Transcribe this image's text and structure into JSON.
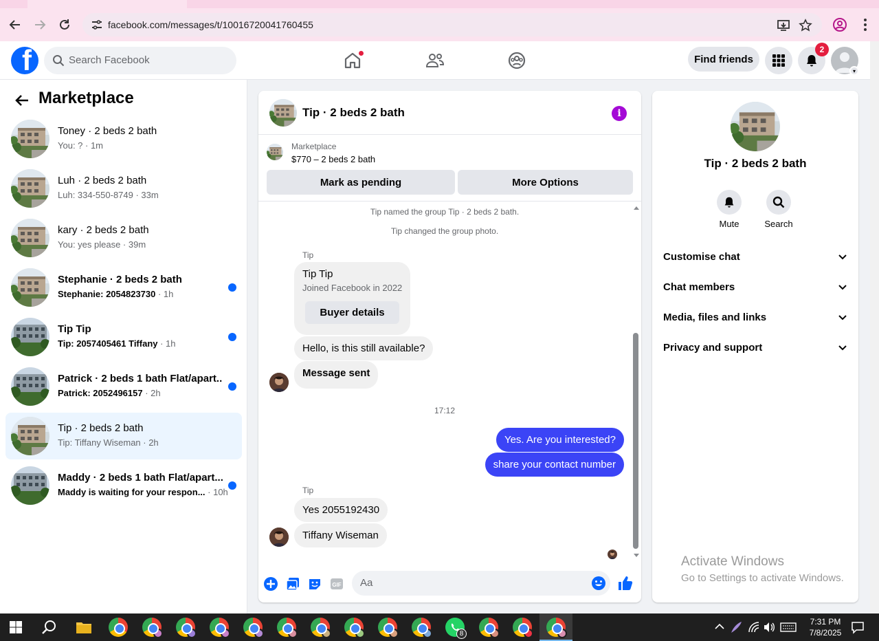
{
  "browser": {
    "url": "facebook.com/messages/t/10016720041760455"
  },
  "header": {
    "search_placeholder": "Search Facebook",
    "find_friends": "Find friends",
    "notification_count": "2"
  },
  "sidebar": {
    "title": "Marketplace",
    "conversations": [
      {
        "name": "Toney · 2 beds 2 bath",
        "preview": "You: ? · 1m",
        "unread": false,
        "active": false
      },
      {
        "name": "Luh · 2 beds 2 bath",
        "preview": "Luh: 334-550-8749 · 33m",
        "unread": false,
        "active": false
      },
      {
        "name": "kary · 2 beds 2 bath",
        "preview": "You: yes please · 39m",
        "unread": false,
        "active": false
      },
      {
        "name": "Stephanie · 2 beds 2 bath",
        "preview": "Stephanie: 2054823730",
        "time": " · 1h",
        "unread": true,
        "active": false
      },
      {
        "name": "Tip Tip",
        "preview": "Tip: 2057405461 Tiffany",
        "time": " · 1h",
        "unread": true,
        "active": false
      },
      {
        "name": "Patrick · 2 beds 1 bath Flat/apart...",
        "preview": "Patrick: 2052496157",
        "time": " · 2h",
        "unread": true,
        "active": false
      },
      {
        "name": "Tip · 2 beds 2 bath",
        "preview": "Tip: Tiffany Wiseman · 2h",
        "unread": false,
        "active": true
      },
      {
        "name": "Maddy · 2 beds 1 bath Flat/apart...",
        "preview": "Maddy is waiting for your respon...",
        "time": " · 10h",
        "unread": true,
        "active": false
      }
    ]
  },
  "chat": {
    "title": "Tip · 2 beds 2 bath",
    "marketplace_label": "Marketplace",
    "listing": "$770 – 2 beds 2 bath",
    "mark_pending": "Mark as pending",
    "more_options": "More Options",
    "system_1": "Tip named the group Tip · 2 beds 2 bath.",
    "system_2": "Tip changed the group photo.",
    "sender_1": "Tip",
    "card_name": "Tip Tip",
    "card_joined": "Joined Facebook in 2022",
    "buyer_details": "Buyer details",
    "msg_available": "Hello, is this still available?",
    "msg_sent": "Message sent",
    "timestamp": "17:12",
    "out_1": "Yes. Are you interested?",
    "out_2": "share your contact number",
    "sender_2": "Tip",
    "in_phone": "Yes 2055192430",
    "in_name": "Tiffany Wiseman",
    "composer_placeholder": "Aa"
  },
  "info_panel": {
    "title": "Tip · 2 beds 2 bath",
    "mute": "Mute",
    "search": "Search",
    "rows": [
      "Customise chat",
      "Chat members",
      "Media, files and links",
      "Privacy and support"
    ]
  },
  "watermark": {
    "line1": "Activate Windows",
    "line2": "Go to Settings to activate Windows."
  },
  "taskbar": {
    "time": "7:31 PM",
    "date": "7/8/2025",
    "whatsapp_badge": "8"
  },
  "colors": {
    "fb_blue": "#0866ff",
    "outgoing_bubble": "#3b44f6",
    "info_purple": "#a40ad6",
    "badge_red": "#e41e3f"
  }
}
